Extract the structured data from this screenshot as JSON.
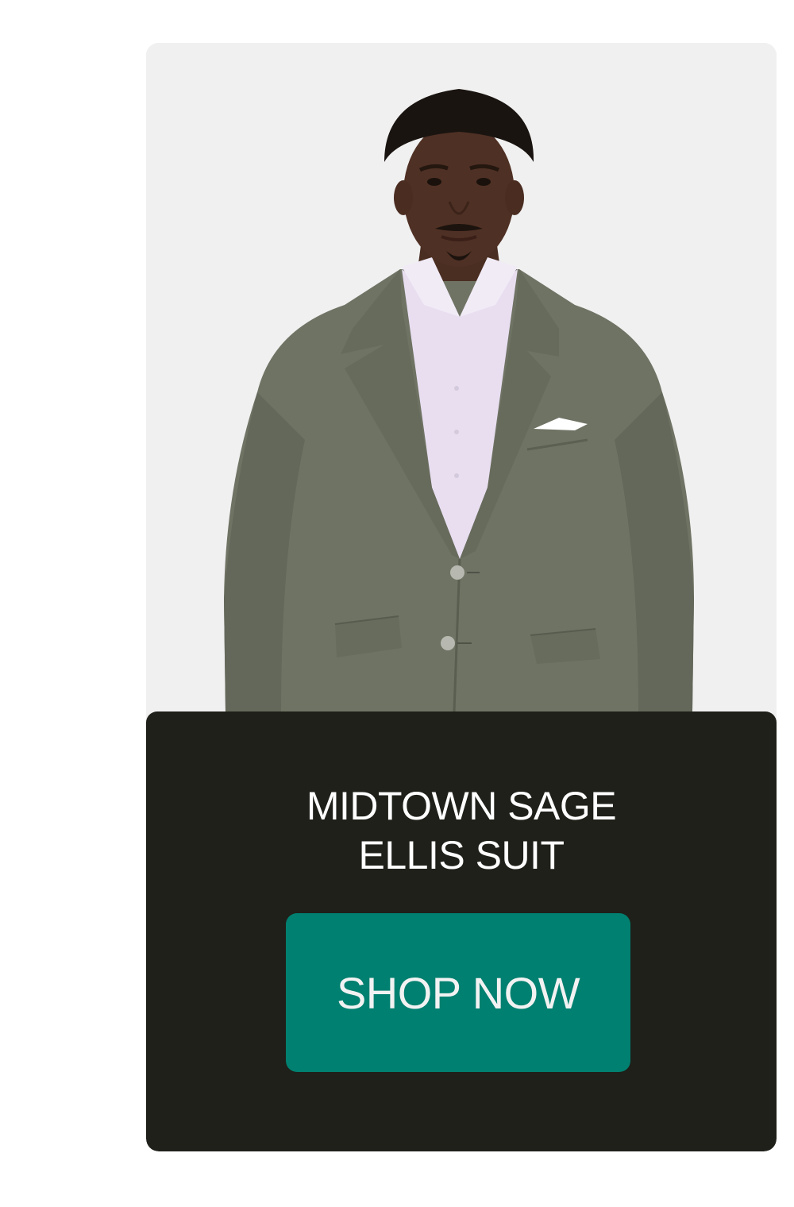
{
  "product": {
    "name_line_1": "MIDTOWN SAGE",
    "name_line_2": "ELLIS SUIT",
    "image_alt": "Model wearing the Midtown Sage Ellis Suit"
  },
  "cta": {
    "label": "SHOP NOW"
  },
  "colors": {
    "card_background": "#f0f0f0",
    "panel_background": "#1e2019",
    "button_background": "#008070",
    "button_text": "#f2f2f2",
    "title_text": "#ffffff",
    "suit": "#6e7263",
    "shirt": "#e6dcef"
  }
}
